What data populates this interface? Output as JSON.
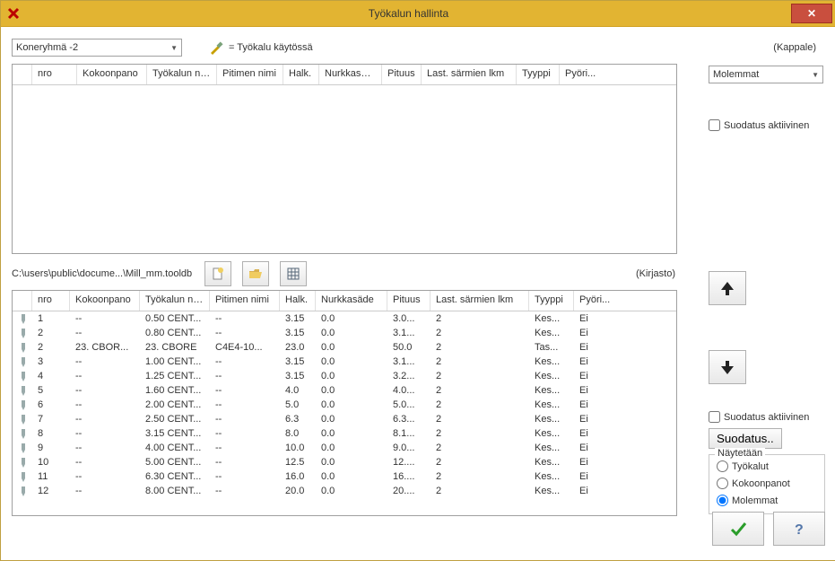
{
  "window": {
    "title": "Työkalun hallinta"
  },
  "top": {
    "machine_group": "Koneryhmä -2",
    "legend": "= Työkalu käytössä",
    "section_top_label": "(Kappale)",
    "section_bottom_label": "(Kirjasto)",
    "view_mode": "Molemmat"
  },
  "columns": {
    "nro": "nro",
    "kokoonpano": "Kokoonpano",
    "tyokalun_nimi": "Työkalun nimi",
    "pitimen_nimi": "Pitimen nimi",
    "halk": "Halk.",
    "nurkkasade": "Nurkkasäde",
    "pituus": "Pituus",
    "last": "Last. särmien lkm",
    "tyyppi": "Tyyppi",
    "pyori": "Pyöri..."
  },
  "path": "C:\\users\\public\\docume...\\Mill_mm.tooldb",
  "filter1": {
    "label": "Suodatus aktiivinen",
    "checked": false
  },
  "filter2": {
    "label": "Suodatus aktiivinen",
    "checked": false
  },
  "filter_button": "Suodatus..",
  "display_group": {
    "title": "Näytetään",
    "opt1": "Työkalut",
    "opt2": "Kokoonpanot",
    "opt3": "Molemmat",
    "selected": "opt3"
  },
  "rows": [
    {
      "nro": "1",
      "kok": "--",
      "tool": "0.50 CENT...",
      "pit": "--",
      "halk": "3.15",
      "ns": "0.0",
      "pituus": "3.0...",
      "last": "2",
      "tyyppi": "Kes...",
      "pyori": "Ei"
    },
    {
      "nro": "2",
      "kok": "--",
      "tool": "0.80 CENT...",
      "pit": "--",
      "halk": "3.15",
      "ns": "0.0",
      "pituus": "3.1...",
      "last": "2",
      "tyyppi": "Kes...",
      "pyori": "Ei"
    },
    {
      "nro": "2",
      "kok": "23. CBOR...",
      "tool": "23. CBORE",
      "pit": "C4E4-10...",
      "halk": "23.0",
      "ns": "0.0",
      "pituus": "50.0",
      "last": "2",
      "tyyppi": "Tas...",
      "pyori": "Ei"
    },
    {
      "nro": "3",
      "kok": "--",
      "tool": "1.00 CENT...",
      "pit": "--",
      "halk": "3.15",
      "ns": "0.0",
      "pituus": "3.1...",
      "last": "2",
      "tyyppi": "Kes...",
      "pyori": "Ei"
    },
    {
      "nro": "4",
      "kok": "--",
      "tool": "1.25 CENT...",
      "pit": "--",
      "halk": "3.15",
      "ns": "0.0",
      "pituus": "3.2...",
      "last": "2",
      "tyyppi": "Kes...",
      "pyori": "Ei"
    },
    {
      "nro": "5",
      "kok": "--",
      "tool": "1.60 CENT...",
      "pit": "--",
      "halk": "4.0",
      "ns": "0.0",
      "pituus": "4.0...",
      "last": "2",
      "tyyppi": "Kes...",
      "pyori": "Ei"
    },
    {
      "nro": "6",
      "kok": "--",
      "tool": "2.00 CENT...",
      "pit": "--",
      "halk": "5.0",
      "ns": "0.0",
      "pituus": "5.0...",
      "last": "2",
      "tyyppi": "Kes...",
      "pyori": "Ei"
    },
    {
      "nro": "7",
      "kok": "--",
      "tool": "2.50 CENT...",
      "pit": "--",
      "halk": "6.3",
      "ns": "0.0",
      "pituus": "6.3...",
      "last": "2",
      "tyyppi": "Kes...",
      "pyori": "Ei"
    },
    {
      "nro": "8",
      "kok": "--",
      "tool": "3.15 CENT...",
      "pit": "--",
      "halk": "8.0",
      "ns": "0.0",
      "pituus": "8.1...",
      "last": "2",
      "tyyppi": "Kes...",
      "pyori": "Ei"
    },
    {
      "nro": "9",
      "kok": "--",
      "tool": "4.00 CENT...",
      "pit": "--",
      "halk": "10.0",
      "ns": "0.0",
      "pituus": "9.0...",
      "last": "2",
      "tyyppi": "Kes...",
      "pyori": "Ei"
    },
    {
      "nro": "10",
      "kok": "--",
      "tool": "5.00 CENT...",
      "pit": "--",
      "halk": "12.5",
      "ns": "0.0",
      "pituus": "12....",
      "last": "2",
      "tyyppi": "Kes...",
      "pyori": "Ei"
    },
    {
      "nro": "11",
      "kok": "--",
      "tool": "6.30 CENT...",
      "pit": "--",
      "halk": "16.0",
      "ns": "0.0",
      "pituus": "16....",
      "last": "2",
      "tyyppi": "Kes...",
      "pyori": "Ei"
    },
    {
      "nro": "12",
      "kok": "--",
      "tool": "8.00 CENT...",
      "pit": "--",
      "halk": "20.0",
      "ns": "0.0",
      "pituus": "20....",
      "last": "2",
      "tyyppi": "Kes...",
      "pyori": "Ei"
    }
  ]
}
